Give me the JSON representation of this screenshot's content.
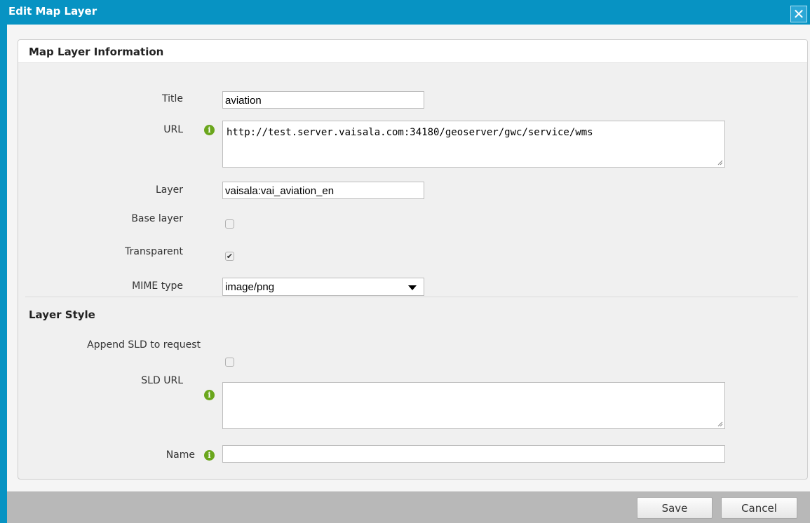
{
  "dialog": {
    "title": "Edit Map Layer",
    "close_glyph": "✕"
  },
  "map_layer_info": {
    "section_title": "Map Layer Information",
    "title_label": "Title",
    "title_value": "aviation",
    "url_label": "URL",
    "url_value": "http://test.server.vaisala.com:34180/geoserver/gwc/service/wms",
    "layer_label": "Layer",
    "layer_value": "vaisala:vai_aviation_en",
    "base_layer_label": "Base layer",
    "base_layer_checked": false,
    "transparent_label": "Transparent",
    "transparent_checked": true,
    "mime_label": "MIME type",
    "mime_value": "image/png"
  },
  "layer_style": {
    "section_title": "Layer Style",
    "append_sld_label": "Append SLD to request",
    "append_sld_checked": false,
    "sld_url_label": "SLD URL",
    "sld_url_value": "",
    "name_label": "Name",
    "name_value": ""
  },
  "footer": {
    "save_label": "Save",
    "cancel_label": "Cancel"
  },
  "icons": {
    "info_glyph": "i",
    "check_glyph": "✔"
  },
  "colors": {
    "title_bar": "#0793c3",
    "info_icon": "#6aa61c",
    "footer_bar": "#b8b8b8"
  }
}
